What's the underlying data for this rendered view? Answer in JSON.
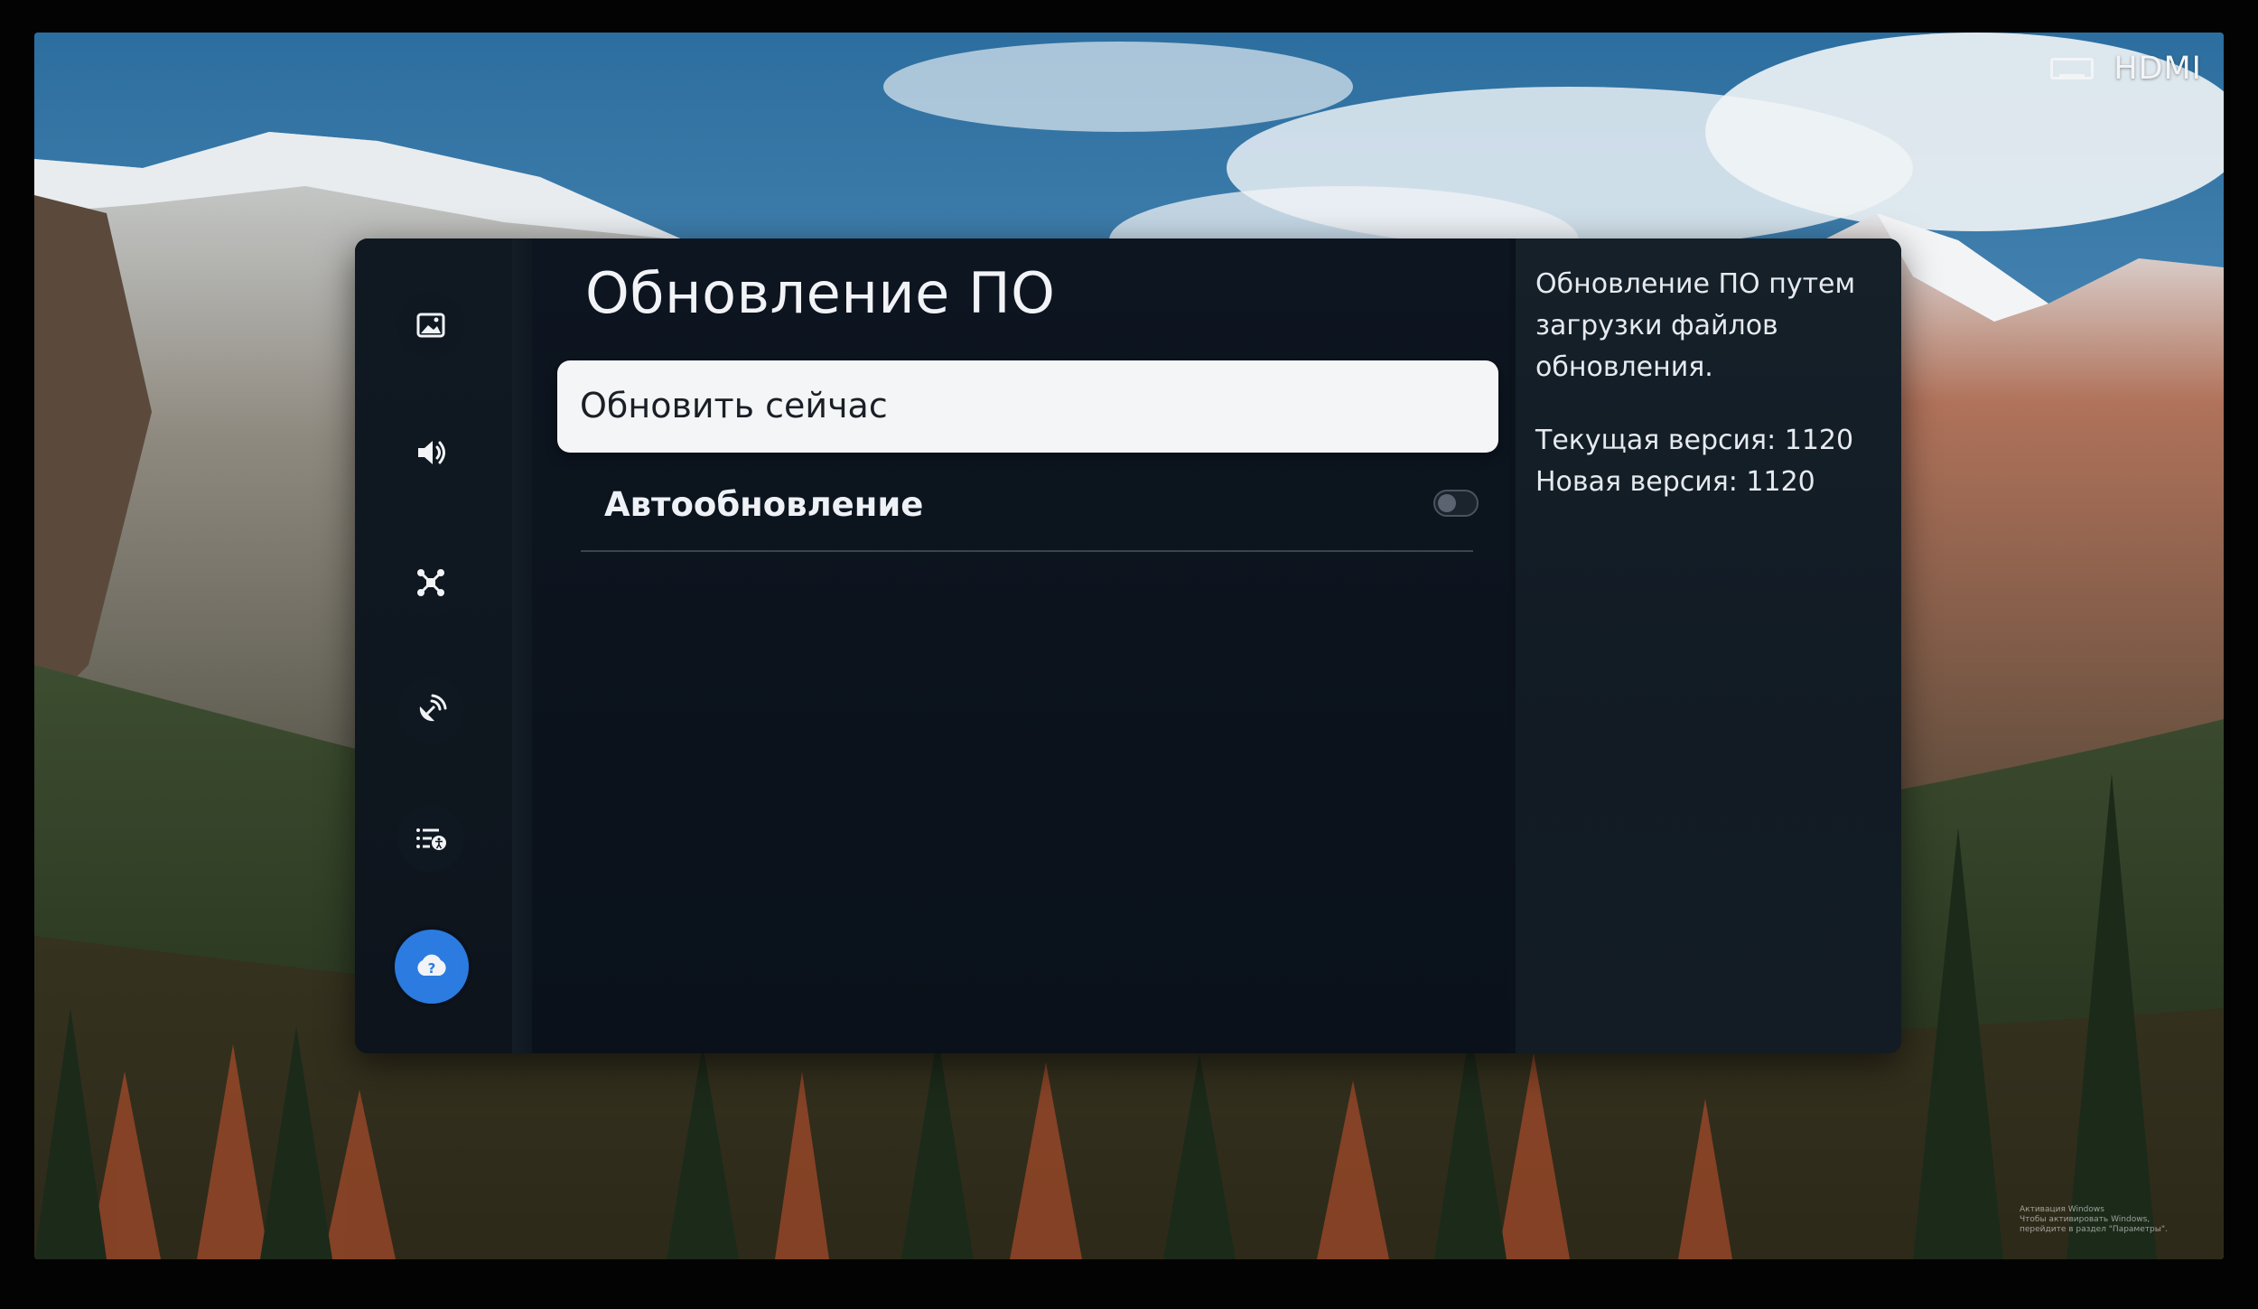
{
  "source": {
    "label": "HDMI",
    "icon": "hdmi-port-icon"
  },
  "sidebar": {
    "items": [
      {
        "id": "picture",
        "icon": "picture-icon",
        "active": false
      },
      {
        "id": "sound",
        "icon": "speaker-icon",
        "active": false
      },
      {
        "id": "connection",
        "icon": "connection-icon",
        "active": false
      },
      {
        "id": "broadcast",
        "icon": "broadcast-icon",
        "active": false
      },
      {
        "id": "general",
        "icon": "general-accessibility-icon",
        "active": false
      },
      {
        "id": "support",
        "icon": "support-question-icon",
        "active": true
      }
    ]
  },
  "main": {
    "title": "Обновление ПО",
    "items": [
      {
        "label": "Обновить сейчас",
        "selected": true
      },
      {
        "label": "Автообновление",
        "selected": false,
        "toggle": false
      }
    ]
  },
  "info": {
    "description": "Обновление ПО путем загрузки файлов обновления.",
    "current_version": "Текущая версия: 1120",
    "new_version": "Новая версия: 1120"
  },
  "watermark": {
    "line1": "Активация Windows",
    "line2": "Чтобы активировать Windows, перейдите в раздел \"Параметры\"."
  },
  "colors": {
    "accent": "#2b7be0",
    "panel_bg": "#0b121b",
    "selected_bg": "#f4f5f7"
  }
}
